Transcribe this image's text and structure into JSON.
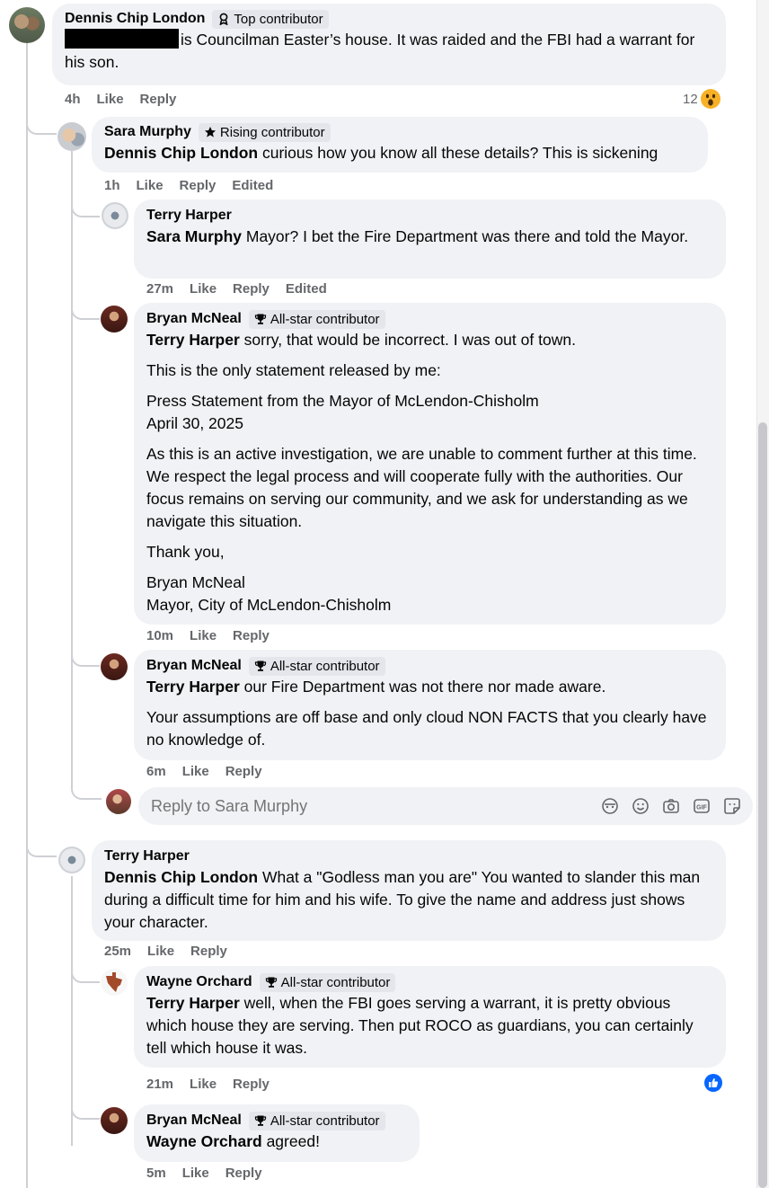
{
  "meta_labels": {
    "like": "Like",
    "reply": "Reply",
    "edited": "Edited"
  },
  "comments": [
    {
      "author": "Dennis Chip London",
      "badge": "Top contributor",
      "badge_icon": "contributor-icon",
      "text_after_redaction": "is Councilman Easter’s house. It was raided and the FBI had a warrant for his son.",
      "time": "4h",
      "reaction_count": "12",
      "reaction": "wow"
    },
    {
      "author": "Sara Murphy",
      "badge": "Rising contributor",
      "badge_icon": "star-icon",
      "mention": "Dennis Chip London",
      "text": "curious how you know all these details? This is sickening",
      "time": "1h"
    },
    {
      "author": "Terry Harper",
      "mention": "Sara Murphy",
      "text": "Mayor? I bet the Fire Department was there and told the Mayor.",
      "time": "27m"
    },
    {
      "author": "Bryan McNeal",
      "badge": "All-star contributor",
      "badge_icon": "trophy-icon",
      "mention": "Terry Harper",
      "text": "sorry, that would be incorrect. I was out of town.",
      "p2": "This is the only statement released by me:",
      "p3a": "Press Statement from the Mayor of McLendon-Chisholm",
      "p3b": "April 30, 2025",
      "p4": "As this is an active investigation, we are unable to comment further at this time. We respect the legal process and will cooperate fully with the authorities. Our focus remains on serving our community, and we ask for understanding as we navigate this situation.",
      "p5": "Thank you,",
      "p6a": "Bryan McNeal",
      "p6b": "Mayor, City of McLendon-Chisholm",
      "time": "10m"
    },
    {
      "author": "Bryan McNeal",
      "badge": "All-star contributor",
      "badge_icon": "trophy-icon",
      "mention": "Terry Harper",
      "text": "our Fire Department was not there nor made aware.",
      "p2": "Your assumptions are off base and only cloud NON FACTS that you clearly have no knowledge of.",
      "time": "6m"
    },
    {
      "author": "Terry Harper",
      "mention": "Dennis Chip London",
      "text": "What a \"Godless man you are\" You wanted to slander this man during a difficult time for him and his wife. To give the name and address just shows your character.",
      "time": "25m"
    },
    {
      "author": "Wayne Orchard",
      "badge": "All-star contributor",
      "badge_icon": "trophy-icon",
      "mention": "Terry Harper",
      "text": "well, when the FBI goes serving a warrant, it is pretty obvious which house they are serving. Then put ROCO as guardians, you can certainly tell which house it was.",
      "time": "21m",
      "reaction": "like"
    },
    {
      "author": "Bryan McNeal",
      "badge": "All-star contributor",
      "badge_icon": "trophy-icon",
      "mention": "Wayne Orchard",
      "text": "agreed!",
      "time": "5m"
    }
  ],
  "reply_box": {
    "placeholder": "Reply to Sara Murphy"
  },
  "colors": {
    "bubble": "#f0f2f5",
    "meta": "#65676b",
    "like_blue": "#0866ff",
    "thread": "#ced0d4"
  }
}
